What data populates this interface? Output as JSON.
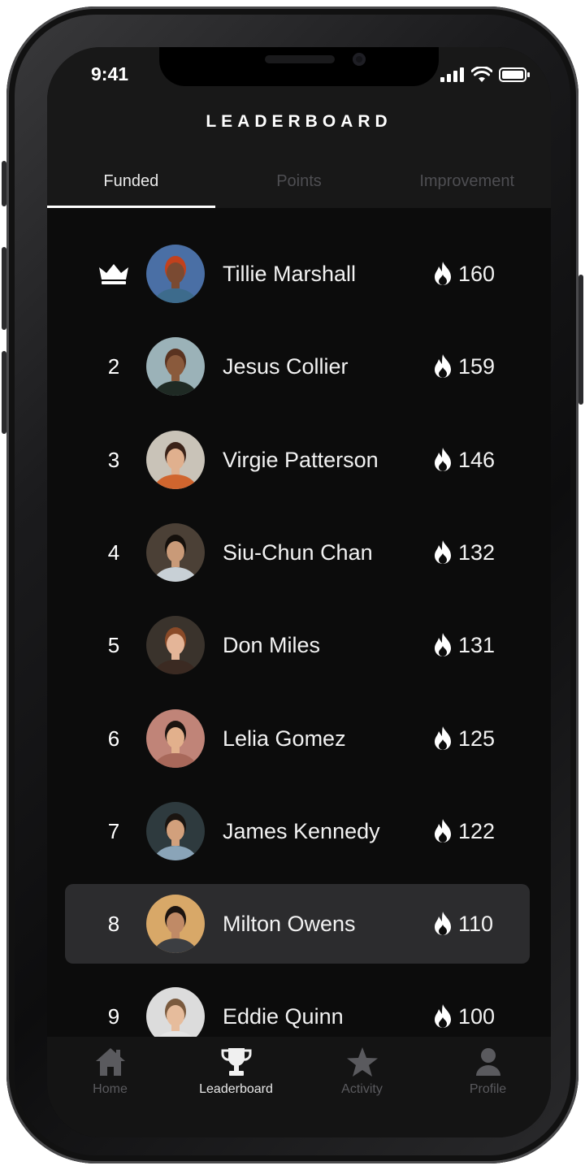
{
  "status_bar": {
    "time": "9:41"
  },
  "header": {
    "title": "LEADERBOARD"
  },
  "tabs": [
    {
      "label": "Funded",
      "active": true
    },
    {
      "label": "Points",
      "active": false
    },
    {
      "label": "Improvement",
      "active": false
    }
  ],
  "leaderboard": [
    {
      "rank": "",
      "rank_icon": "crown-icon",
      "name": "Tillie Marshall",
      "score": "160",
      "avatar_bg": "#4a6fa5",
      "skin": "#7a4a32",
      "hair": "#c2411d",
      "shirt": "#3d6b8c"
    },
    {
      "rank": "2",
      "name": "Jesus Collier",
      "score": "159",
      "avatar_bg": "#9bb2b8",
      "skin": "#8a5a3c",
      "hair": "#5a3320",
      "shirt": "#1f2a24"
    },
    {
      "rank": "3",
      "name": "Virgie Patterson",
      "score": "146",
      "avatar_bg": "#c9c3b8",
      "skin": "#e0b08e",
      "hair": "#3a2218",
      "shirt": "#d0652e"
    },
    {
      "rank": "4",
      "name": "Siu-Chun Chan",
      "score": "132",
      "avatar_bg": "#4b4036",
      "skin": "#c99a78",
      "hair": "#15100c",
      "shirt": "#c8d0d6"
    },
    {
      "rank": "5",
      "name": "Don Miles",
      "score": "131",
      "avatar_bg": "#3a332c",
      "skin": "#e4b598",
      "hair": "#8a4a28",
      "shirt": "#3b2a22"
    },
    {
      "rank": "6",
      "name": "Lelia Gomez",
      "score": "125",
      "avatar_bg": "#c08478",
      "skin": "#e2b08c",
      "hair": "#1c1410",
      "shirt": "#a8685a"
    },
    {
      "rank": "7",
      "name": "James Kennedy",
      "score": "122",
      "avatar_bg": "#2e3a3e",
      "skin": "#d2a07c",
      "hair": "#1a1410",
      "shirt": "#8aa4b8"
    },
    {
      "rank": "8",
      "name": "Milton Owens",
      "score": "110",
      "avatar_bg": "#d8a868",
      "skin": "#c08a66",
      "hair": "#1c1410",
      "shirt": "#3c3e42",
      "highlight": true
    },
    {
      "rank": "9",
      "name": "Eddie Quinn",
      "score": "100",
      "avatar_bg": "#dcdcdc",
      "skin": "#e6bc9c",
      "hair": "#7a5a3e",
      "shirt": "#e4e4e4"
    }
  ],
  "bottom_nav": [
    {
      "label": "Home",
      "icon": "home-icon",
      "active": false
    },
    {
      "label": "Leaderboard",
      "icon": "trophy-icon",
      "active": true
    },
    {
      "label": "Activity",
      "icon": "star-icon",
      "active": false
    },
    {
      "label": "Profile",
      "icon": "person-icon",
      "active": false
    }
  ]
}
